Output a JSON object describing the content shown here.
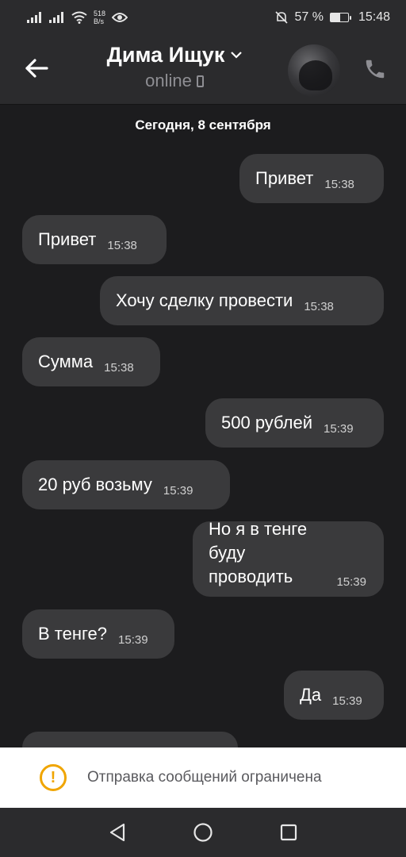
{
  "status_bar": {
    "speed_value": "518",
    "speed_unit": "B/s",
    "battery_percent": "57 %",
    "battery_level": 0.57,
    "time": "15:48"
  },
  "header": {
    "contact_name": "Дима Ищук",
    "status": "online"
  },
  "chat": {
    "date_separator": "Сегодня, 8 сентября",
    "messages": [
      {
        "direction": "outgoing",
        "lines": [
          "Привет"
        ],
        "time": "15:38"
      },
      {
        "direction": "incoming",
        "lines": [
          "Привет"
        ],
        "time": "15:38"
      },
      {
        "direction": "outgoing",
        "lines": [
          "Хочу сделку провести"
        ],
        "time": "15:38"
      },
      {
        "direction": "incoming",
        "lines": [
          "Сумма"
        ],
        "time": "15:38"
      },
      {
        "direction": "outgoing",
        "lines": [
          "500 рублей"
        ],
        "time": "15:39"
      },
      {
        "direction": "incoming",
        "lines": [
          "20 руб возьму"
        ],
        "time": "15:39"
      },
      {
        "direction": "outgoing",
        "lines": [
          "Но я в тенге буду",
          "проводить"
        ],
        "time": "15:39"
      },
      {
        "direction": "incoming",
        "lines": [
          "В тенге?"
        ],
        "time": "15:39"
      },
      {
        "direction": "outgoing",
        "lines": [
          "Да"
        ],
        "time": "15:39"
      }
    ]
  },
  "banner": {
    "text": "Отправка сообщений ограничена"
  },
  "colors": {
    "background": "#1c1c1e",
    "bar": "#2b2b2d",
    "bubble": "#3a3a3c",
    "warning": "#f0a500"
  }
}
